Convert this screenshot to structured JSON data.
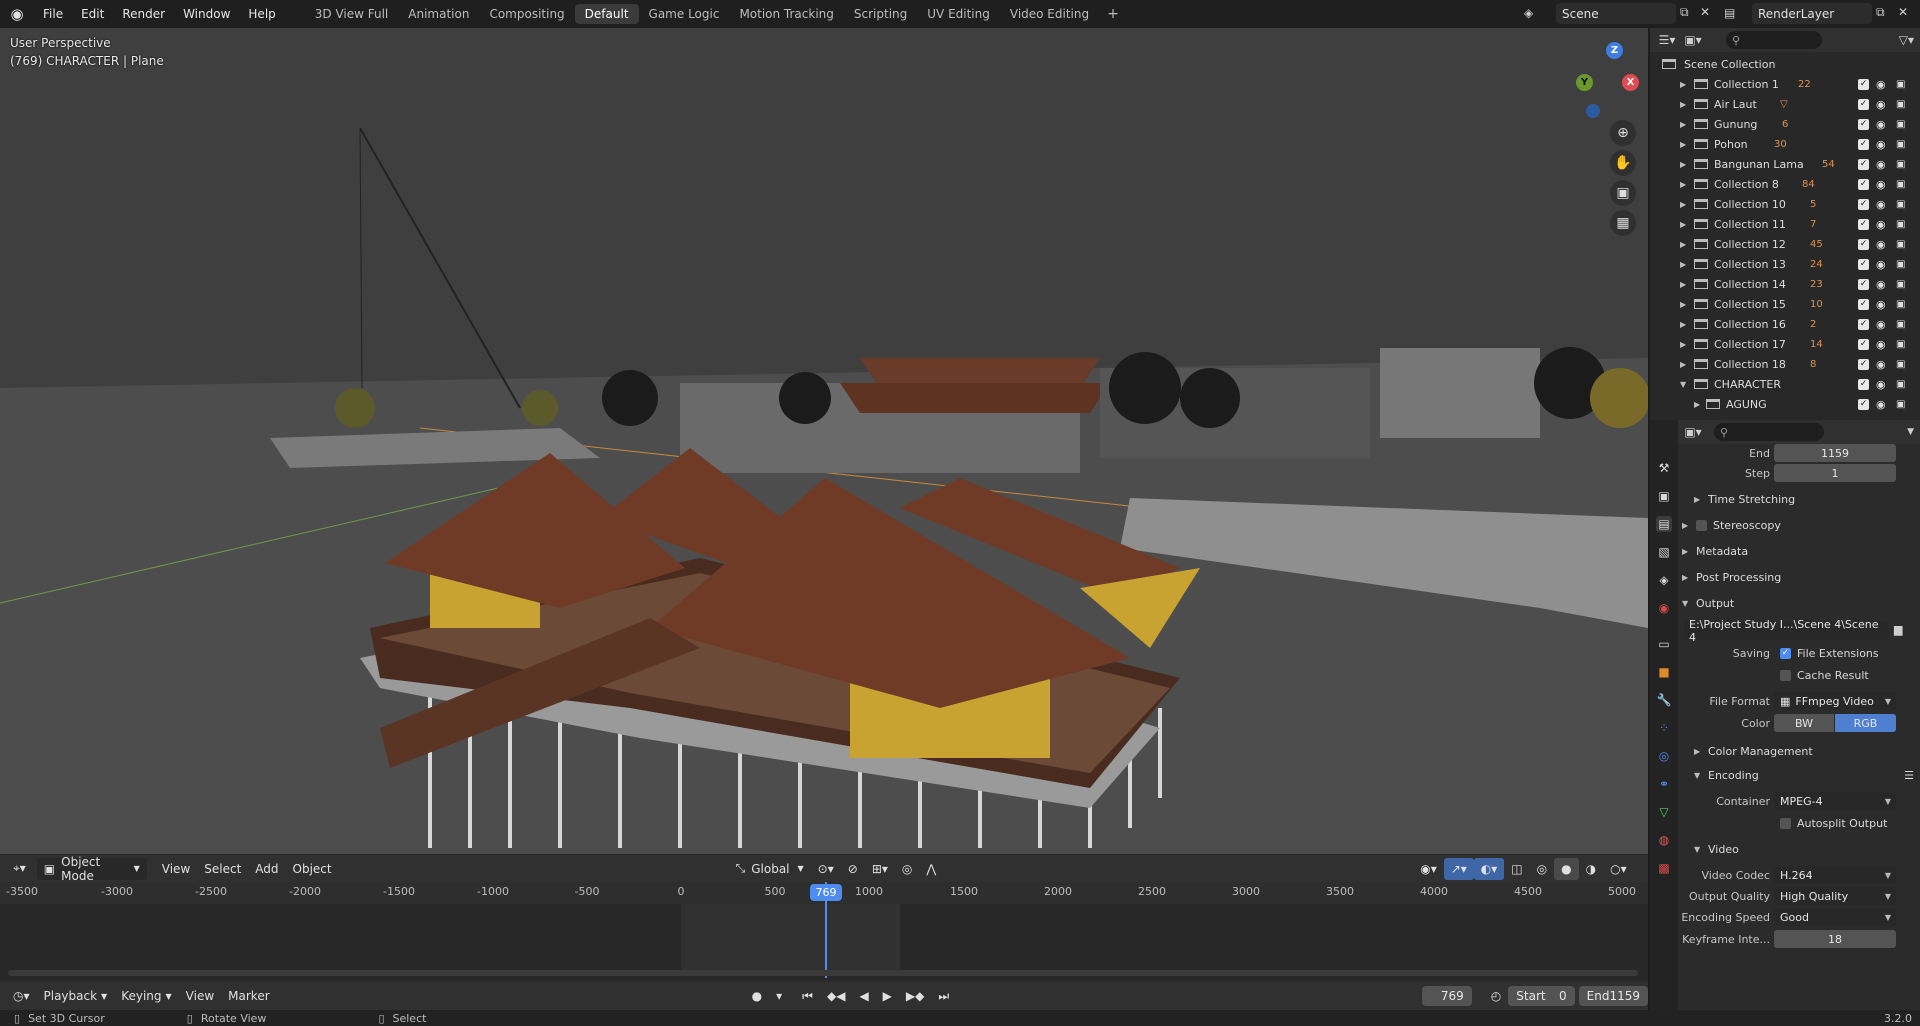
{
  "app": {
    "menu": [
      "File",
      "Edit",
      "Render",
      "Window",
      "Help"
    ],
    "workspaces": [
      "3D View Full",
      "Animation",
      "Compositing",
      "Default",
      "Game Logic",
      "Motion Tracking",
      "Scripting",
      "UV Editing",
      "Video Editing"
    ],
    "active_workspace": "Default",
    "add_workspace": "+",
    "scene": "Scene",
    "render_layer": "RenderLayer"
  },
  "viewport": {
    "perspective": "User Perspective",
    "object_info": "(769) CHARACTER | Plane",
    "gizmo": {
      "z": "Z",
      "x": "X",
      "y": "Y"
    },
    "header": {
      "mode": "Object Mode",
      "menus": [
        "View",
        "Select",
        "Add",
        "Object"
      ],
      "orientation": "Global"
    }
  },
  "timeline": {
    "ticks": [
      "-3500",
      "-3000",
      "-2500",
      "-2000",
      "-1500",
      "-1000",
      "-500",
      "0",
      "500",
      "1000",
      "1500",
      "2000",
      "2500",
      "3000",
      "3500",
      "4000",
      "4500",
      "5000"
    ],
    "current_frame": "769",
    "menus": [
      "Playback",
      "Keying",
      "View",
      "Marker"
    ],
    "frame_field": "769",
    "start_label": "Start",
    "start_value": "0",
    "end_label": "End",
    "end_value": "1159"
  },
  "statusbar": {
    "items": [
      "Set 3D Cursor",
      "Rotate View",
      "Select"
    ],
    "version": "3.2.0"
  },
  "outliner": {
    "root": "Scene Collection",
    "rows": [
      {
        "label": "Collection 1",
        "badge": "22"
      },
      {
        "label": "Air Laut",
        "badge": ""
      },
      {
        "label": "Gunung",
        "badge": "6"
      },
      {
        "label": "Pohon",
        "badge": "30"
      },
      {
        "label": "Bangunan Lama",
        "badge": "54"
      },
      {
        "label": "Collection 8",
        "badge": "84"
      },
      {
        "label": "Collection 10",
        "badge": "5"
      },
      {
        "label": "Collection 11",
        "badge": "7"
      },
      {
        "label": "Collection 12",
        "badge": "45"
      },
      {
        "label": "Collection 13",
        "badge": "24"
      },
      {
        "label": "Collection 14",
        "badge": "23"
      },
      {
        "label": "Collection 15",
        "badge": "10"
      },
      {
        "label": "Collection 16",
        "badge": "2"
      },
      {
        "label": "Collection 17",
        "badge": "14"
      },
      {
        "label": "Collection 18",
        "badge": "8"
      },
      {
        "label": "CHARACTER",
        "badge": ""
      },
      {
        "label": "AGUNG",
        "badge": ""
      }
    ]
  },
  "properties": {
    "end_label": "End",
    "end_value": "1159",
    "step_label": "Step",
    "step_value": "1",
    "sections": {
      "time_stretching": "Time Stretching",
      "stereoscopy": "Stereoscopy",
      "metadata": "Metadata",
      "post_processing": "Post Processing",
      "output": "Output",
      "color_management": "Color Management",
      "encoding": "Encoding",
      "video": "Video"
    },
    "output_path": "E:\\Project Study I...\\Scene 4\\Scene 4",
    "saving_label": "Saving",
    "file_extensions": "File Extensions",
    "cache_result": "Cache Result",
    "file_format_label": "File Format",
    "file_format": "FFmpeg Video",
    "color_label": "Color",
    "color_bw": "BW",
    "color_rgb": "RGB",
    "container_label": "Container",
    "container": "MPEG-4",
    "autosplit": "Autosplit Output",
    "video_codec_label": "Video Codec",
    "video_codec": "H.264",
    "output_quality_label": "Output Quality",
    "output_quality": "High Quality",
    "encoding_speed_label": "Encoding Speed",
    "encoding_speed": "Good",
    "keyframe_label": "Keyframe Inte...",
    "keyframe_value": "18"
  }
}
